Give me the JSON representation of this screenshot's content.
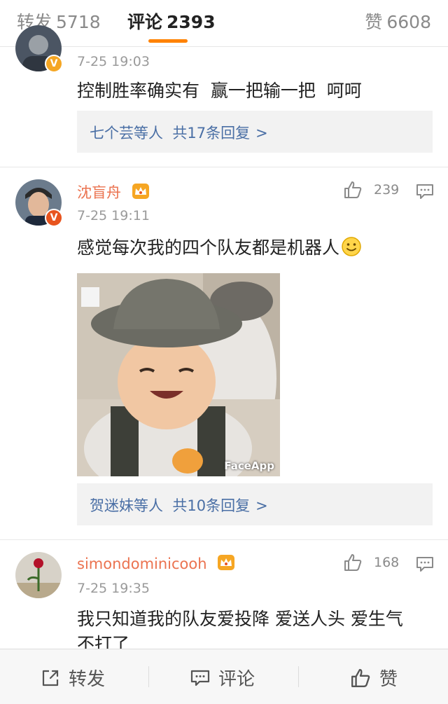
{
  "tabs": {
    "repost": {
      "label": "转发",
      "count": "5718"
    },
    "comments": {
      "label": "评论",
      "count": "2393"
    },
    "likes": {
      "label": "赞",
      "count": "6608"
    }
  },
  "comments": [
    {
      "time": "7-25 19:03",
      "text": "控制胜率确实有  赢一把输一把  呵呵",
      "replies": {
        "names": "七个芸等人",
        "summary": "共17条回复",
        "chevron": ">"
      },
      "badge": "V",
      "badge_color": "#f5a623"
    },
    {
      "username": "沈盲舟",
      "time": "7-25 19:11",
      "likes": "239",
      "text": "感觉每次我的四个队友都是机器人",
      "image_watermark": "FaceApp",
      "replies": {
        "names": "贺迷妹等人",
        "summary": "共10条回复",
        "chevron": ">"
      },
      "badge": "V",
      "badge_color": "#e8541e"
    },
    {
      "username": "simondominicooh",
      "time": "7-25 19:35",
      "likes": "168",
      "text_line1": "我只知道我的队友爱投降 爱送人头 爱生气",
      "text_line2": "不打了"
    }
  ],
  "bottom": {
    "repost": "转发",
    "comment": "评论",
    "like": "赞"
  },
  "colors": {
    "accent": "#ff8200",
    "username": "#eb7350",
    "link": "#4a6fa5"
  }
}
